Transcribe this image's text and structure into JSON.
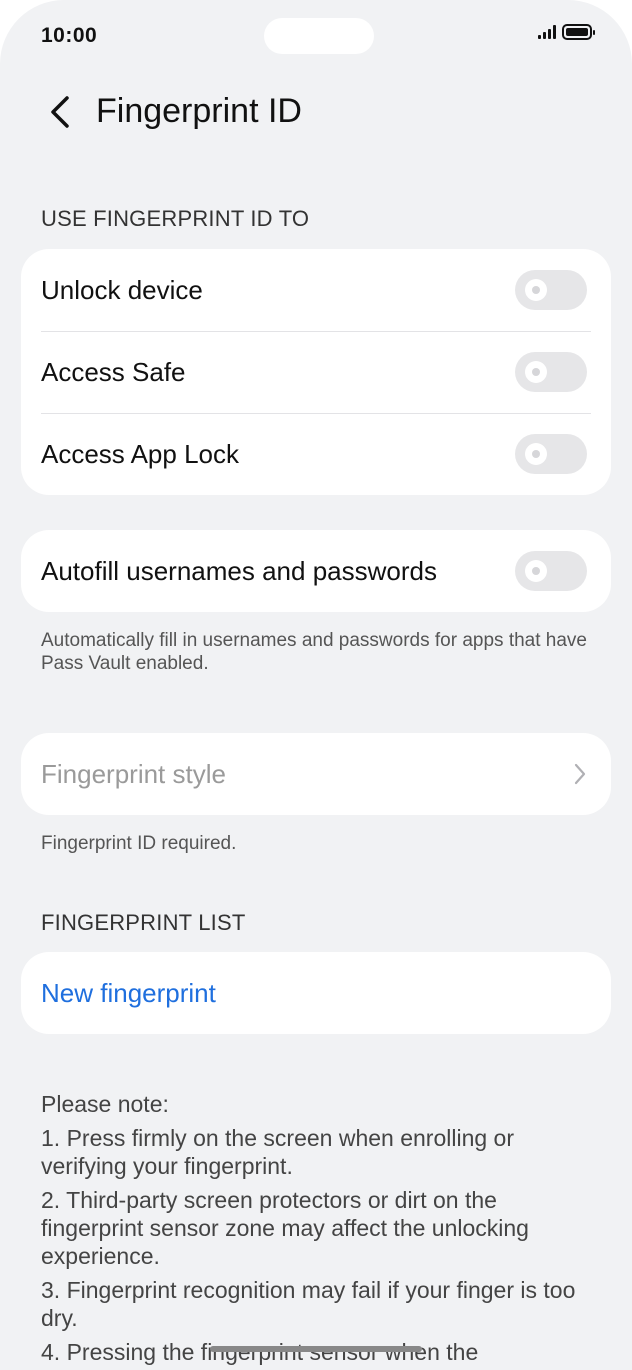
{
  "status_bar": {
    "time": "10:00"
  },
  "header": {
    "back_icon": "chevron-left-icon",
    "title": "Fingerprint ID"
  },
  "use_section": {
    "label": "USE FINGERPRINT ID TO",
    "items": [
      {
        "label": "Unlock device",
        "enabled": false
      },
      {
        "label": "Access Safe",
        "enabled": false
      },
      {
        "label": "Access App Lock",
        "enabled": false
      }
    ]
  },
  "autofill": {
    "label": "Autofill usernames and passwords",
    "enabled": false,
    "description": "Automatically fill in usernames and passwords for apps that have Pass Vault enabled."
  },
  "style": {
    "label": "Fingerprint style",
    "note": "Fingerprint ID required."
  },
  "list_section": {
    "label": "FINGERPRINT LIST",
    "new_label": "New fingerprint"
  },
  "notes": {
    "heading": "Please note:",
    "items": [
      "1. Press firmly on the screen when enrolling or verifying your fingerprint.",
      "2. Third-party screen protectors or dirt on the fingerprint sensor zone may affect the unlocking experience.",
      "3. Fingerprint recognition may fail if your finger is too dry.",
      "4. Pressing the fingerprint sensor when the"
    ]
  },
  "colors": {
    "background": "#f1f2f4",
    "card": "#ffffff",
    "accent": "#1f6fde",
    "toggle_off": "#e6e6e8"
  }
}
